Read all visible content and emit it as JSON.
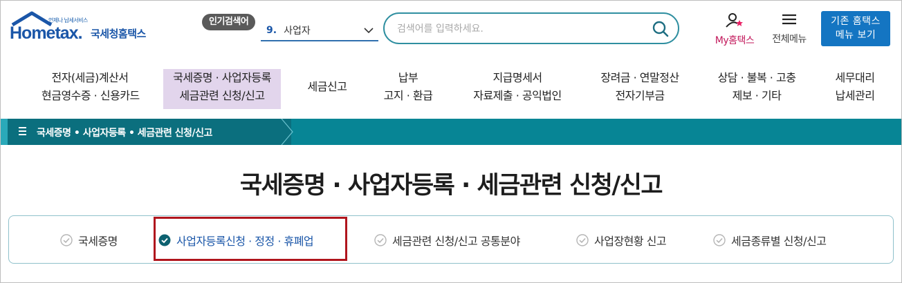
{
  "header": {
    "logo_sub": "언제나 납세서비스",
    "logo_main": "Hometax.",
    "logo_kr": "국세청홈택스",
    "popular_badge": "인기검색어",
    "popular_rank": "9.",
    "popular_term": "사업자",
    "search_placeholder": "검색어를 입력하세요.",
    "my_hometax": "My홈택스",
    "all_menu": "전체메뉴",
    "legacy_line1": "기존 홈택스",
    "legacy_line2": "메뉴 보기"
  },
  "nav": [
    {
      "line1": "전자(세금)계산서",
      "line2": "현금영수증 · 신용카드"
    },
    {
      "line1": "국세증명 · 사업자등록",
      "line2": "세금관련 신청/신고",
      "active": true
    },
    {
      "line1": "세금신고",
      "line2": ""
    },
    {
      "line1": "납부",
      "line2": "고지 · 환급"
    },
    {
      "line1": "지급명세서",
      "line2": "자료제출 · 공익법인"
    },
    {
      "line1": "장려금 · 연말정산",
      "line2": "전자기부금"
    },
    {
      "line1": "상담 · 불복 · 고충",
      "line2": "제보 · 기타"
    },
    {
      "line1": "세무대리",
      "line2": "납세관리"
    }
  ],
  "breadcrumb": "국세증명 • 사업자등록 • 세금관련 신청/신고",
  "page_title": "국세증명 · 사업자등록 · 세금관련 신청/신고",
  "subtabs": [
    {
      "label": "국세증명",
      "active": false
    },
    {
      "label": "사업자등록신청 · 정정 · 휴폐업",
      "active": true
    },
    {
      "label": "세금관련 신청/신고 공통분야",
      "active": false
    },
    {
      "label": "사업장현황 신고",
      "active": false
    },
    {
      "label": "세금종류별 신청/신고",
      "active": false
    }
  ],
  "colors": {
    "brand_blue": "#1a56a8",
    "teal_bar": "#078595",
    "active_nav_bg": "#e2d5ec",
    "highlight_red": "#b0151d",
    "my_pink": "#c2185b"
  },
  "icons": [
    "search-icon",
    "user-star-icon",
    "hamburger-icon",
    "chevron-down-icon",
    "check-circle-icon"
  ]
}
